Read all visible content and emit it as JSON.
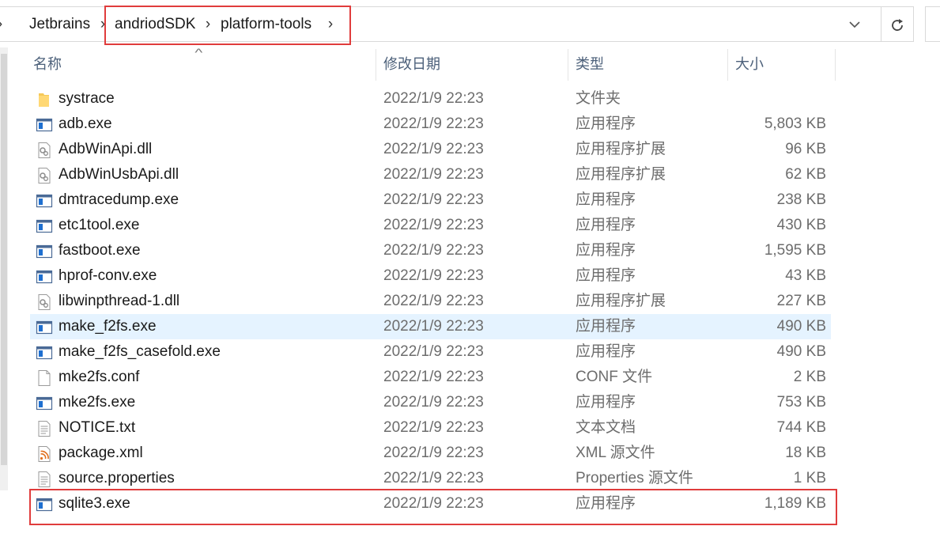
{
  "address_bar": {
    "crumbs": [
      "Jetbrains",
      "andriodSDK",
      "platform-tools"
    ],
    "dropdown_icon": "chevron-down-icon",
    "refresh_icon": "refresh-icon"
  },
  "columns": {
    "name": "名称",
    "date": "修改日期",
    "type": "类型",
    "size": "大小"
  },
  "files": [
    {
      "name": "systrace",
      "date": "2022/1/9 22:23",
      "type": "文件夹",
      "size": "",
      "icon": "folder-icon"
    },
    {
      "name": "adb.exe",
      "date": "2022/1/9 22:23",
      "type": "应用程序",
      "size": "5,803 KB",
      "icon": "exe-icon"
    },
    {
      "name": "AdbWinApi.dll",
      "date": "2022/1/9 22:23",
      "type": "应用程序扩展",
      "size": "96 KB",
      "icon": "dll-icon"
    },
    {
      "name": "AdbWinUsbApi.dll",
      "date": "2022/1/9 22:23",
      "type": "应用程序扩展",
      "size": "62 KB",
      "icon": "dll-icon"
    },
    {
      "name": "dmtracedump.exe",
      "date": "2022/1/9 22:23",
      "type": "应用程序",
      "size": "238 KB",
      "icon": "exe-icon"
    },
    {
      "name": "etc1tool.exe",
      "date": "2022/1/9 22:23",
      "type": "应用程序",
      "size": "430 KB",
      "icon": "exe-icon"
    },
    {
      "name": "fastboot.exe",
      "date": "2022/1/9 22:23",
      "type": "应用程序",
      "size": "1,595 KB",
      "icon": "exe-icon"
    },
    {
      "name": "hprof-conv.exe",
      "date": "2022/1/9 22:23",
      "type": "应用程序",
      "size": "43 KB",
      "icon": "exe-icon"
    },
    {
      "name": "libwinpthread-1.dll",
      "date": "2022/1/9 22:23",
      "type": "应用程序扩展",
      "size": "227 KB",
      "icon": "dll-icon"
    },
    {
      "name": "make_f2fs.exe",
      "date": "2022/1/9 22:23",
      "type": "应用程序",
      "size": "490 KB",
      "icon": "exe-icon",
      "selected": true
    },
    {
      "name": "make_f2fs_casefold.exe",
      "date": "2022/1/9 22:23",
      "type": "应用程序",
      "size": "490 KB",
      "icon": "exe-icon"
    },
    {
      "name": "mke2fs.conf",
      "date": "2022/1/9 22:23",
      "type": "CONF 文件",
      "size": "2 KB",
      "icon": "file-icon"
    },
    {
      "name": "mke2fs.exe",
      "date": "2022/1/9 22:23",
      "type": "应用程序",
      "size": "753 KB",
      "icon": "exe-icon"
    },
    {
      "name": "NOTICE.txt",
      "date": "2022/1/9 22:23",
      "type": "文本文档",
      "size": "744 KB",
      "icon": "text-file-icon"
    },
    {
      "name": "package.xml",
      "date": "2022/1/9 22:23",
      "type": "XML 源文件",
      "size": "18 KB",
      "icon": "xml-icon"
    },
    {
      "name": "source.properties",
      "date": "2022/1/9 22:23",
      "type": "Properties 源文件",
      "size": "1 KB",
      "icon": "text-file-icon"
    },
    {
      "name": "sqlite3.exe",
      "date": "2022/1/9 22:23",
      "type": "应用程序",
      "size": "1,189 KB",
      "icon": "exe-icon"
    }
  ],
  "colors": {
    "highlight": "#e03c3c",
    "selection": "#e5f3ff",
    "header_text": "#4c607a",
    "secondary_text": "#6d6d6d"
  }
}
